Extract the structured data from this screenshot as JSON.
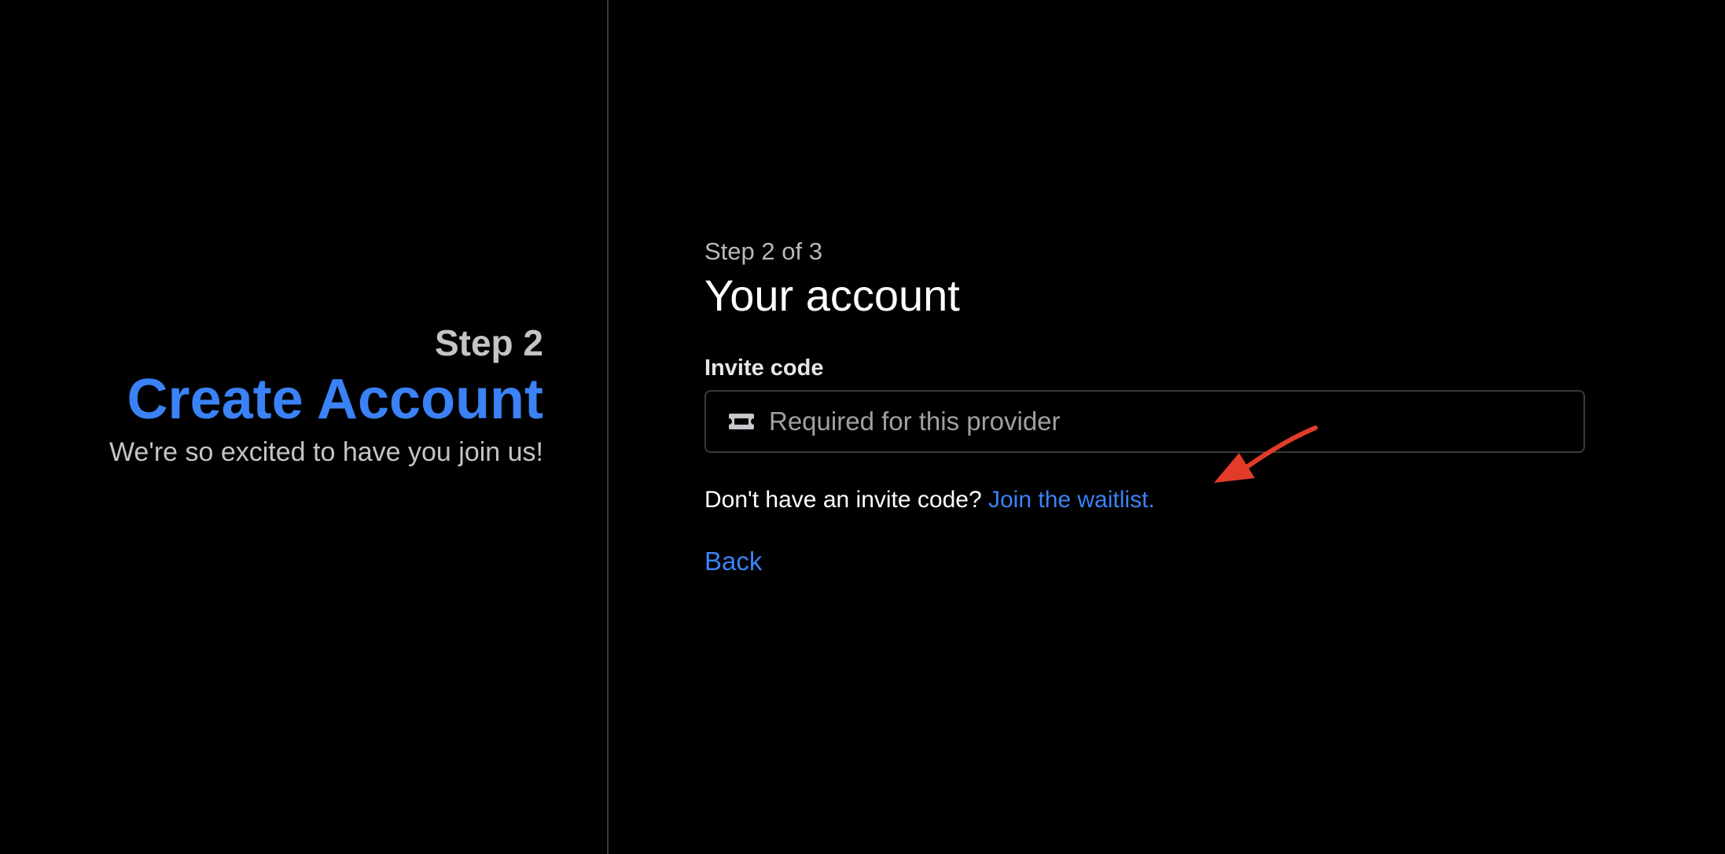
{
  "left": {
    "step": "Step 2",
    "title": "Create Account",
    "subtitle": "We're so excited to have you join us!"
  },
  "form": {
    "step_indicator": "Step 2 of 3",
    "title": "Your account",
    "invite_label": "Invite code",
    "invite_placeholder": "Required for this provider",
    "invite_value": "",
    "waitlist_prompt": "Don't have an invite code?",
    "waitlist_link": "Join the waitlist.",
    "back_label": "Back"
  },
  "icons": {
    "input_icon": "ticket-icon",
    "annotation": "red-arrow-annotation"
  },
  "colors": {
    "background": "#000000",
    "accent": "#3a82f6",
    "muted_text": "#c4c4c6",
    "border": "#3a3a3c",
    "annotation": "#e23b2a"
  }
}
